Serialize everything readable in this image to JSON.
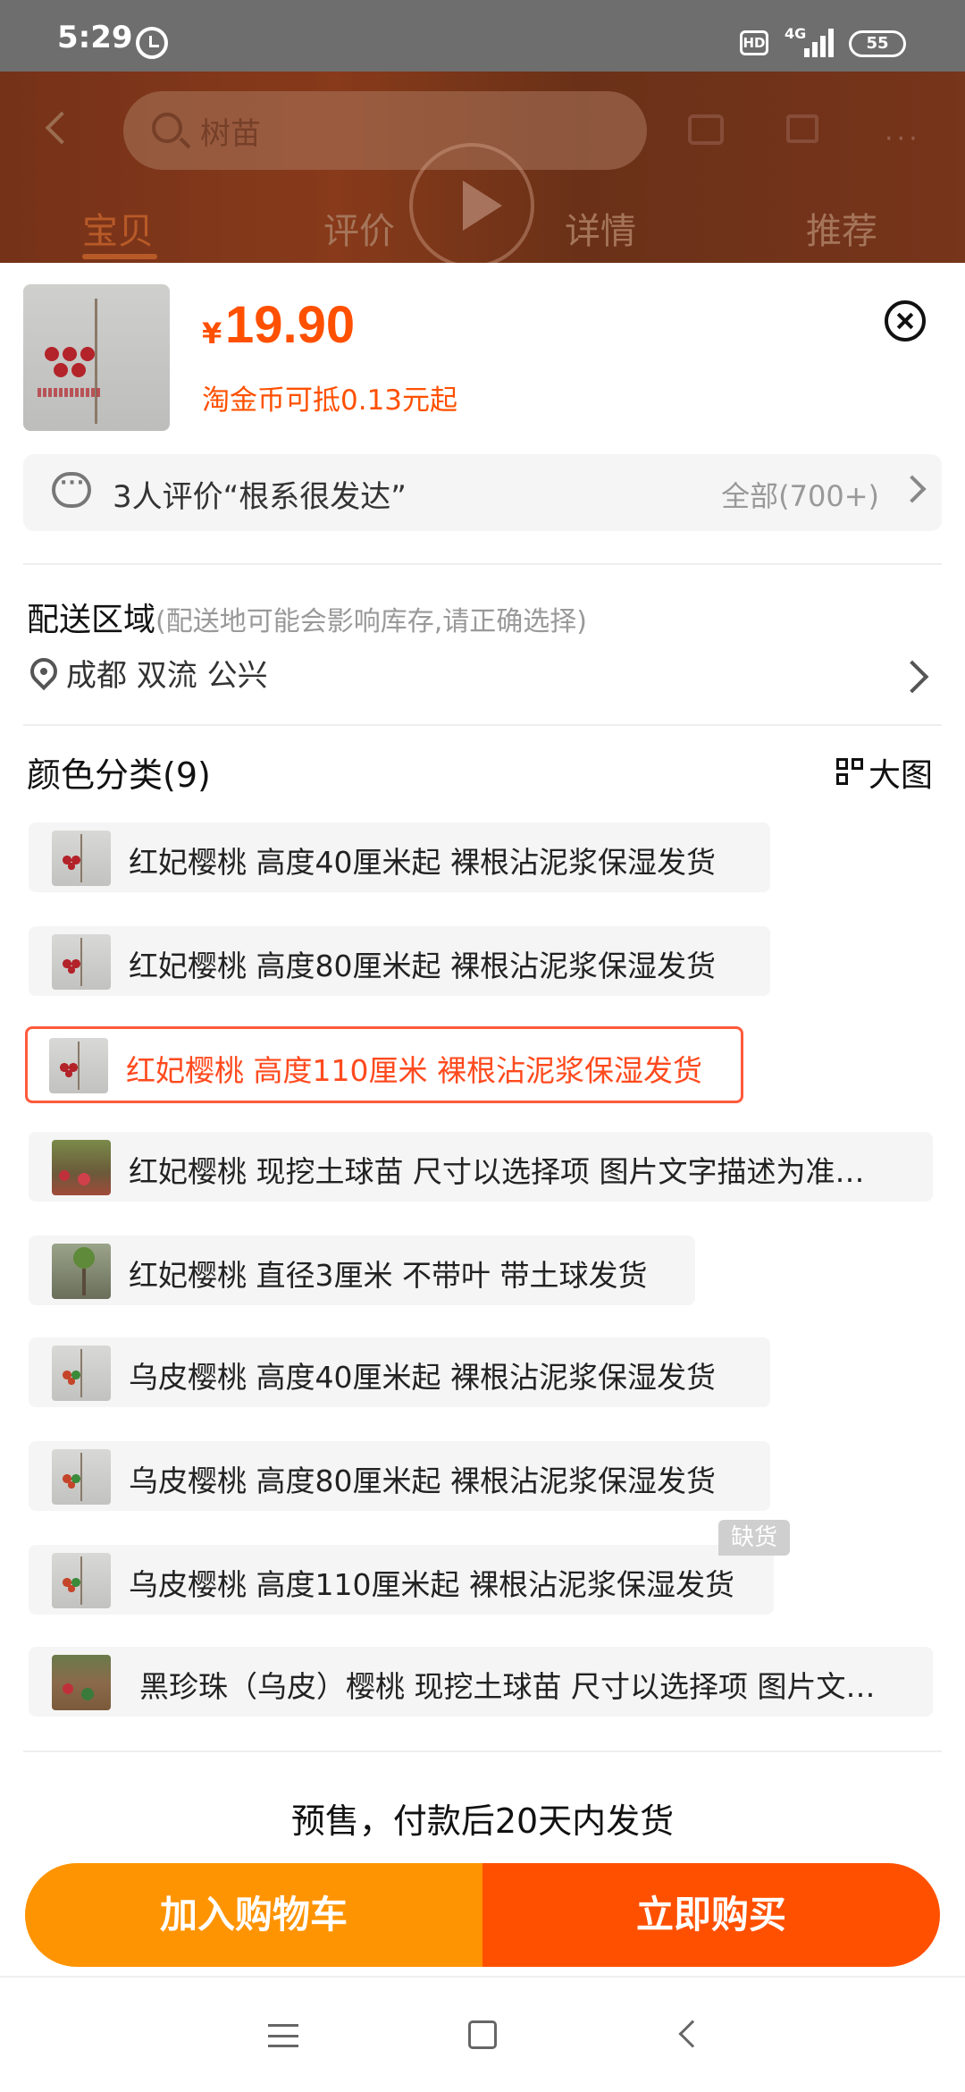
{
  "status_bar": {
    "time": "5:29",
    "hd_badge": "HD",
    "network": "4G",
    "battery": "55"
  },
  "background_page": {
    "search_text": "树苗",
    "tabs": [
      "宝贝",
      "评价",
      "详情",
      "推荐"
    ]
  },
  "sheet": {
    "currency": "¥",
    "price": "19.90",
    "coin_note": "淘金币可抵0.13元起",
    "review": {
      "text": "3人评价“根系很发达”",
      "all_label": "全部(700+)"
    },
    "delivery": {
      "title": "配送区域",
      "note": "(配送地可能会影响库存,请正确选择)",
      "location": "成都 双流 公兴"
    },
    "color_section": {
      "title": "颜色分类(9)",
      "big_picture_label": "大图",
      "selected_index": 2,
      "out_of_stock_label": "缺货",
      "options": [
        "红妃樱桃 高度40厘米起 裸根沾泥浆保湿发货",
        "红妃樱桃 高度80厘米起 裸根沾泥浆保湿发货",
        "红妃樱桃 高度110厘米 裸根沾泥浆保湿发货",
        "红妃樱桃 现挖土球苗 尺寸以选择项 图片文字描述为准…",
        "红妃樱桃 直径3厘米 不带叶 带土球发货",
        "乌皮樱桃 高度40厘米起 裸根沾泥浆保湿发货",
        "乌皮樱桃 高度80厘米起 裸根沾泥浆保湿发货",
        "乌皮樱桃 高度110厘米起 裸根沾泥浆保湿发货",
        "黑珍珠（乌皮）樱桃 现挖土球苗 尺寸以选择项 图片文…"
      ]
    },
    "presale_note": "预售，付款后20天内发货",
    "add_cart_label": "加入购物车",
    "buy_now_label": "立即购买"
  },
  "colors": {
    "accent": "#ff5000",
    "cart_button": "#ff9402",
    "buy_button": "#ff5000"
  }
}
